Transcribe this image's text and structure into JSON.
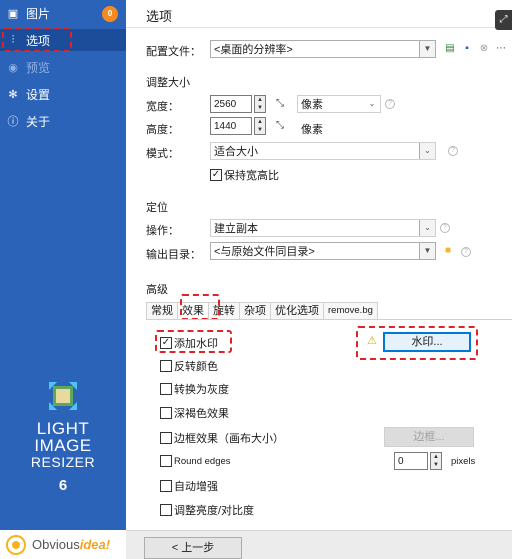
{
  "sidebar": {
    "items": [
      {
        "label": "图片",
        "icon": "image-icon",
        "badge": "0"
      },
      {
        "label": "选项",
        "icon": "sliders-icon"
      },
      {
        "label": "预览",
        "icon": "eye-icon"
      },
      {
        "label": "设置",
        "icon": "gear-icon"
      },
      {
        "label": "关于",
        "icon": "info-icon"
      }
    ],
    "logo_lines": [
      "LIGHT",
      "IMAGE",
      "RESIZER"
    ],
    "version": "6",
    "brand": {
      "prefix": "Obvious",
      "suffix": "idea!"
    }
  },
  "main": {
    "title": "选项",
    "profile": {
      "label": "配置文件：",
      "value": "<桌面的分辨率>"
    },
    "resize": {
      "title": "调整大小",
      "width_label": "宽度：",
      "width_value": "2560",
      "height_label": "高度：",
      "height_value": "1440",
      "unit_selected": "像素",
      "unit_static": "像素",
      "mode_label": "模式：",
      "mode_value": "适合大小",
      "keep_ratio_label": "保持宽高比",
      "keep_ratio_checked": true
    },
    "location": {
      "title": "定位",
      "action_label": "操作：",
      "action_value": "建立副本",
      "output_label": "输出目录：",
      "output_value": "<与原始文件同目录>"
    },
    "advanced": {
      "title": "高级",
      "tabs": [
        "常规",
        "效果",
        "旋转",
        "杂项",
        "优化选项",
        "remove.bg"
      ],
      "active_tab": "效果",
      "effects": [
        {
          "label": "添加水印",
          "checked": true
        },
        {
          "label": "反转颜色",
          "checked": false
        },
        {
          "label": "转换为灰度",
          "checked": false
        },
        {
          "label": "深褐色效果",
          "checked": false
        },
        {
          "label": "边框效果（画布大小）",
          "checked": false
        },
        {
          "label": "Round edges",
          "checked": false
        },
        {
          "label": "自动增强",
          "checked": false
        },
        {
          "label": "调整亮度/对比度",
          "checked": false
        }
      ],
      "watermark_button": "水印...",
      "border_button": "边框...",
      "round_value": "0",
      "round_unit": "pixels"
    },
    "back_button": "< 上一步"
  },
  "colors": {
    "sidebar": "#2b63b9",
    "highlight": "#e0232a",
    "badge": "#f58a20",
    "accent": "#0078d7"
  }
}
